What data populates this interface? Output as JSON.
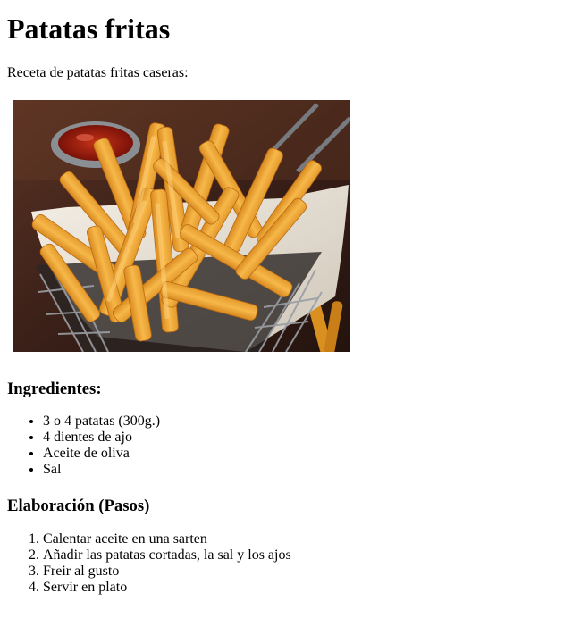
{
  "page": {
    "title": "Patatas fritas",
    "intro": "Receta de patatas fritas caseras:",
    "image_subject": "basket-of-french-fries"
  },
  "ingredients": {
    "heading": "Ingredientes:",
    "items": [
      "3 o 4 patatas (300g.)",
      "4 dientes de ajo",
      "Aceite de oliva",
      "Sal"
    ]
  },
  "steps": {
    "heading": "Elaboración (Pasos)",
    "items": [
      "Calentar aceite en una sarten",
      "Añadir las patatas cortadas, la sal y los ajos",
      "Freir al gusto",
      "Servir en plato"
    ]
  },
  "colors": {
    "background": "#ffffff",
    "text": "#000000",
    "fries": "#f2a93b",
    "wood_background": "#3a2018"
  }
}
